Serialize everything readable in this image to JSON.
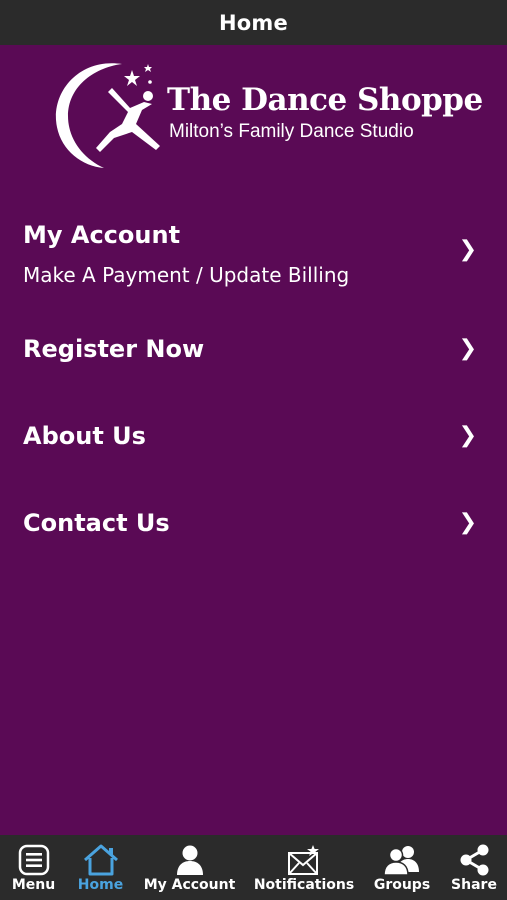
{
  "header": {
    "title": "Home"
  },
  "logo": {
    "brand": "The Dance Shoppe",
    "tagline": "Milton’s Family Dance Studio"
  },
  "menu": [
    {
      "label": "My Account",
      "sub": "Make A Payment / Update Billing"
    },
    {
      "label": "Register Now"
    },
    {
      "label": "About Us"
    },
    {
      "label": "Contact Us"
    }
  ],
  "chevron": "❯",
  "tabs": [
    {
      "label": "Menu",
      "icon": "menu-icon"
    },
    {
      "label": "Home",
      "icon": "home-icon",
      "active": true
    },
    {
      "label": "My Account",
      "icon": "user-icon"
    },
    {
      "label": "Notifications",
      "icon": "envelope-star-icon"
    },
    {
      "label": "Groups",
      "icon": "group-icon"
    },
    {
      "label": "Share",
      "icon": "share-icon"
    }
  ],
  "colors": {
    "background": "#5a0a55",
    "bar": "#2b2b2b",
    "active": "#4aa3df",
    "text": "#ffffff"
  }
}
